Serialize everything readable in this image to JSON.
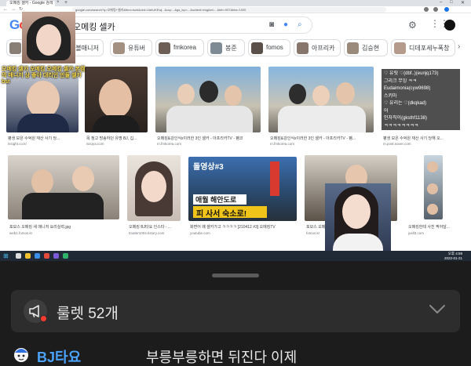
{
  "browser": {
    "tab_title": "오메킹 셀카 - Google 검색",
    "url": "google.com/search?q=오메킹+셀카&tbm=isch&ved=2ahUKEwj...&oq=...&gs_lcp=...&sclient=img&ei=...&bih=937&biw=1920",
    "window_controls": [
      "–",
      "□",
      "✕"
    ]
  },
  "search": {
    "query": "오메킹 셀카"
  },
  "google_logo": {
    "g1": "G",
    "o1": "o",
    "o2": "o"
  },
  "chips": [
    {
      "label": "옷볼매니저"
    },
    {
      "label": "유튜버"
    },
    {
      "label": "fmkorea"
    },
    {
      "label": "봉준"
    },
    {
      "label": "fomos"
    },
    {
      "label": "아프리카"
    },
    {
      "label": "김승현"
    },
    {
      "label": "디데포세누폭창"
    }
  ],
  "results": [
    {
      "caption": "평생 모은 수억원 재산 사기 당...",
      "source": "insight.co.kr"
    },
    {
      "caption": "목 청고 방송하던 유명 BJ, 깁...",
      "source": "issuya.com"
    },
    {
      "caption": "오메킹&강인식x이러한 3인 셀카 - 아프리카TV - 펨코",
      "source": "m.fmkorea.com"
    },
    {
      "caption": "오메킹&강인식x이러한 3인 셀카 - 아프리카TV - 펨...",
      "source": "m.fmkorea.com"
    },
    {
      "caption": "평생 모은 수억원 재산 사기 당해 오...",
      "source": "m.post.naver.com"
    },
    {
      "caption": "포모스 오메킹 새 매니저 요리실력.jpg",
      "source": "web1.fomos.kr"
    },
    {
      "caption": "오메킹 BJ타요 인스타 - ...",
      "source": "tmater1004.tistory.com"
    },
    {
      "caption": "화면어 왜 셀카가고 ㅋㅋㅋㅋ [210412 #3] 오메킹TV",
      "source": "youtube.com"
    },
    {
      "caption": "포모스 오메킹 ...",
      "source": "fomos.kr"
    },
    {
      "caption": "오메킹한테 사진 찍어달...",
      "source": "jusll3.com"
    }
  ],
  "thumb_texts": {
    "video_tag": "돌영상#3",
    "video_title_1": "애월 해안도로",
    "video_title_2": "피 사서 숙소로!"
  },
  "overlay_stamp": "오메킹 셀카 오메킹 오메킹 셀카 본캠의 매니저 상 좋아 대리인 만들 셀카 bst",
  "chat_overlay": [
    {
      "text": "♡ 유릿 ♡(dbf..)(eunjq173)"
    },
    {
      "text": "그리크 무잉 ㅋㅋ"
    },
    {
      "text": "Eudaimonia(cyw9698)"
    },
    {
      "text": "스키마"
    },
    {
      "text": "♡ 유리는 ♡(dkqkad)"
    },
    {
      "text": "어"
    },
    {
      "text": "인자직이(gksthf1138)"
    },
    {
      "text": "ㅋㅋㅋㅋㅋㅋㅋㅋ"
    }
  ],
  "taskbar": {
    "start": "⊞",
    "time": "오후 4:59",
    "date": "2022-01-21"
  },
  "panel": {
    "roulette_label": "룰렛 52개",
    "message": {
      "nickname": "BJ타요",
      "text": "부릉부릉하면 뒤진다 이제"
    }
  },
  "colors": {
    "google_blue": "#4285f4",
    "google_red": "#ea4335",
    "google_yellow": "#fbbc05",
    "google_green": "#34a853",
    "nickname_blue": "#4aa3ff",
    "panel_bg": "#1c1c1c",
    "roulette_bg": "#2d2d2d",
    "notice_red": "#ff3b30"
  },
  "icons": [
    "megaphone-icon",
    "chevron-down-icon",
    "camera-search-icon",
    "mic-icon",
    "search-icon",
    "settings-icon",
    "apps-icon",
    "avatar"
  ]
}
